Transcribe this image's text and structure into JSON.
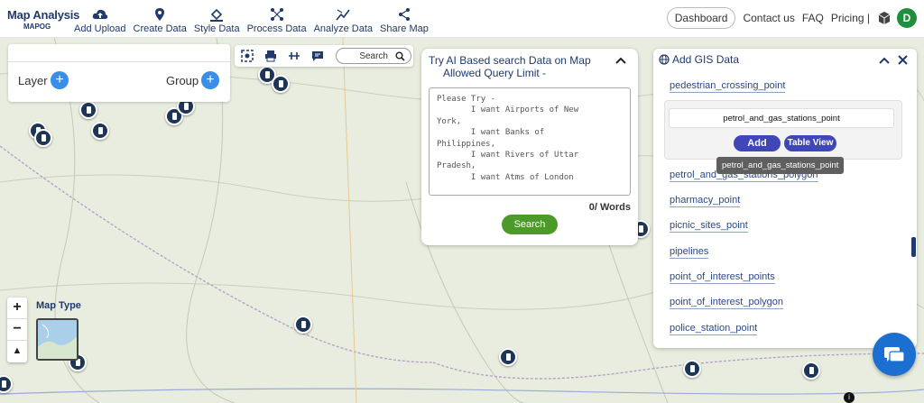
{
  "brand": {
    "title": "Map Analysis",
    "subtitle": "MAPOG"
  },
  "nav": [
    {
      "label": "Add Upload",
      "icon": "cloud-upload-icon"
    },
    {
      "label": "Create Data",
      "icon": "map-pin-icon"
    },
    {
      "label": "Style Data",
      "icon": "paint-bucket-icon"
    },
    {
      "label": "Process Data",
      "icon": "process-icon"
    },
    {
      "label": "Analyze Data",
      "icon": "analyze-icon"
    },
    {
      "label": "Share Map",
      "icon": "share-icon"
    }
  ],
  "right_nav": {
    "dashboard": "Dashboard",
    "contact": "Contact us",
    "faq": "FAQ",
    "pricing": "Pricing |",
    "avatar": "D"
  },
  "layer_panel": {
    "layer": "Layer",
    "group": "Group"
  },
  "toolbar": {
    "search": "Search",
    "icons": [
      "locate-icon",
      "print-icon",
      "measure-icon",
      "comment-icon",
      "search-icon"
    ]
  },
  "ai_panel": {
    "title_line1": "Try AI Based search Data on Map",
    "title_line2": "Allowed Query Limit -",
    "prompt": "Please Try -\n       I want Airports of New\nYork,\n       I want Banks of\nPhilippines,\n       I want Rivers of Uttar\nPradesh,\n       I want Atms of London",
    "words": "0/ Words",
    "search_button": "Search"
  },
  "gis_panel": {
    "title": "Add GIS Data",
    "items_top": [
      "pedestrian_crossing_point"
    ],
    "selected": "petrol_and_gas_stations_point",
    "add_button": "Add",
    "table_button": "Table View",
    "tooltip": "petrol_and_gas_stations_point",
    "items": [
      "petrol_and_gas_stations_polygon",
      "pharmacy_point",
      "picnic_sites_point",
      "pipelines",
      "point_of_interest_points",
      "point_of_interest_polygon",
      "police_station_point"
    ]
  },
  "map_controls": {
    "zoom_in": "+",
    "zoom_out": "−",
    "reset": "▲",
    "map_type": "Map Type"
  },
  "colors": {
    "brand": "#1f3a6b",
    "accent_blue": "#3a8ee6",
    "green": "#4c9a2a",
    "button_indigo": "#3f46b8",
    "avatar_green": "#1e8f3c"
  }
}
